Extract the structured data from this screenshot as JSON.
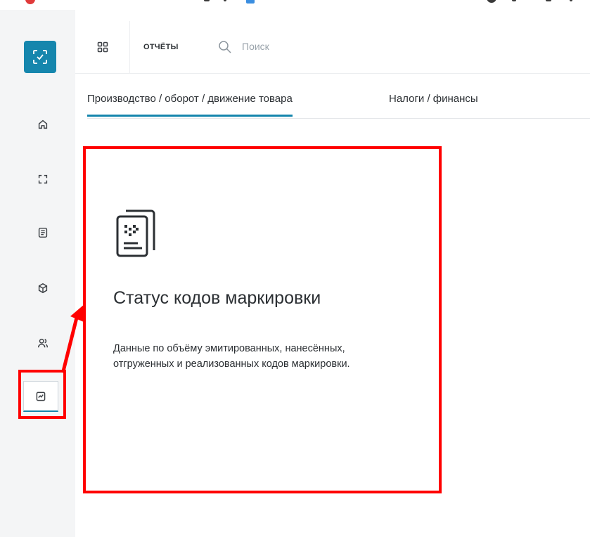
{
  "header": {
    "section_title": "ОТЧЁТЫ",
    "search_placeholder": "Поиск"
  },
  "sidebar": {
    "items": [
      {
        "icon": "home-icon"
      },
      {
        "icon": "scan-icon"
      },
      {
        "icon": "document-icon"
      },
      {
        "icon": "box-icon"
      },
      {
        "icon": "users-icon"
      },
      {
        "icon": "reports-icon",
        "active": true
      }
    ]
  },
  "tabs": [
    {
      "label": "Производство / оборот / движение товара",
      "active": true
    },
    {
      "label": "Налоги / финансы",
      "active": false
    }
  ],
  "card": {
    "icon": "marking-codes-document-icon",
    "title": "Статус кодов маркировки",
    "description": "Данные по объёму эмитированных, нанесённых, отгруженных и реализованных кодов маркировки."
  },
  "colors": {
    "accent": "#1586ad",
    "annotation": "#ff0000",
    "sidebar_bg": "#f4f5f6"
  }
}
